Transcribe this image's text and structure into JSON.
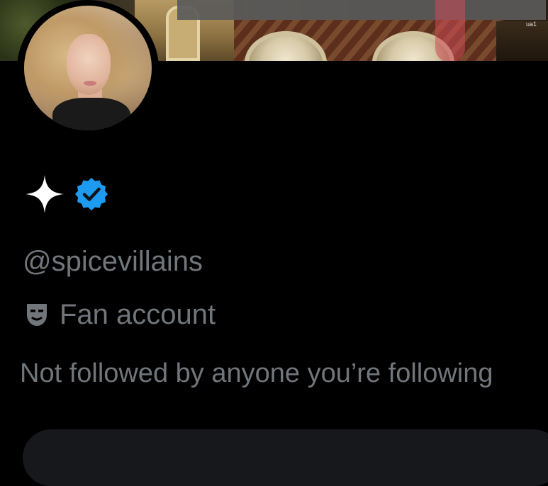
{
  "banner": {
    "corner_text": "ua1"
  },
  "profile": {
    "display_name_icon": "sparkle-icon",
    "verified_icon": "verified-badge-icon",
    "handle": "@spicevillains",
    "category_icon": "theater-masks-icon",
    "category": "Fan account",
    "followers_note": "Not followed by anyone you’re following"
  },
  "colors": {
    "background": "#000000",
    "secondary_text": "#71767b",
    "verified_blue": "#1d9bf0",
    "sparkle": "#ffffff"
  }
}
